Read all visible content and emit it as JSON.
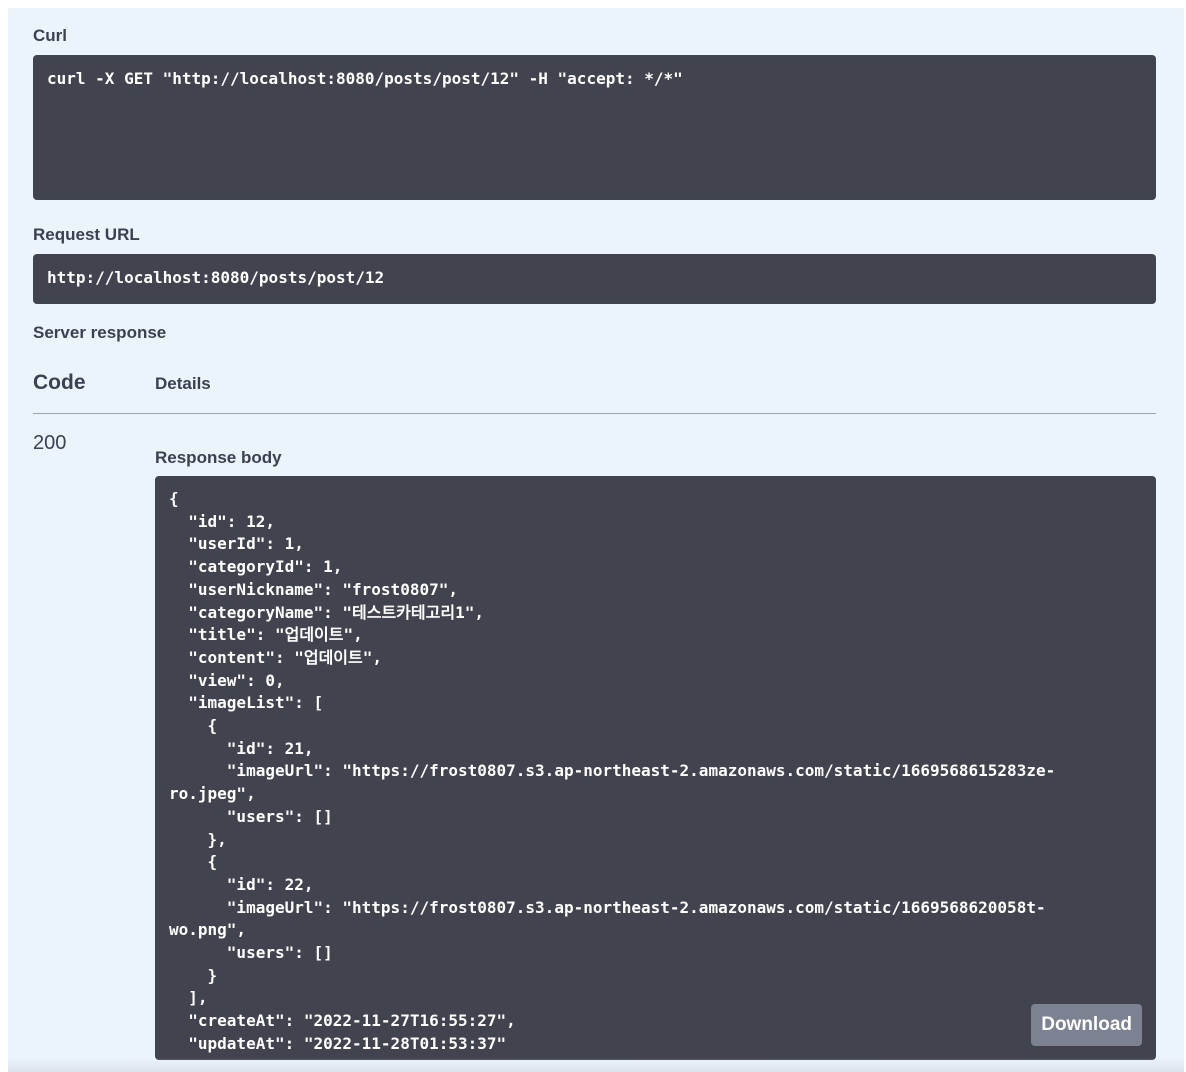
{
  "curl": {
    "label": "Curl",
    "command": "curl -X GET \"http://localhost:8080/posts/post/12\" -H \"accept: */*\""
  },
  "request_url": {
    "label": "Request URL",
    "url": "http://localhost:8080/posts/post/12"
  },
  "server_response": {
    "label": "Server response",
    "code_header": "Code",
    "details_header": "Details",
    "status_code": "200",
    "response_body_label": "Response body",
    "response_body": "{\n  \"id\": 12,\n  \"userId\": 1,\n  \"categoryId\": 1,\n  \"userNickname\": \"frost0807\",\n  \"categoryName\": \"테스트카테고리1\",\n  \"title\": \"업데이트\",\n  \"content\": \"업데이트\",\n  \"view\": 0,\n  \"imageList\": [\n    {\n      \"id\": 21,\n      \"imageUrl\": \"https://frost0807.s3.ap-northeast-2.amazonaws.com/static/1669568615283ze-\nro.jpeg\",\n      \"users\": []\n    },\n    {\n      \"id\": 22,\n      \"imageUrl\": \"https://frost0807.s3.ap-northeast-2.amazonaws.com/static/1669568620058t-\nwo.png\",\n      \"users\": []\n    }\n  ],\n  \"createAt\": \"2022-11-27T16:55:27\",\n  \"updateAt\": \"2022-11-28T01:53:37\"",
    "download_label": "Download"
  },
  "colors": {
    "panel_background": "#ebf3fb",
    "code_background": "#41444e",
    "download_button": "#7d8293",
    "text": "#3b4151"
  }
}
